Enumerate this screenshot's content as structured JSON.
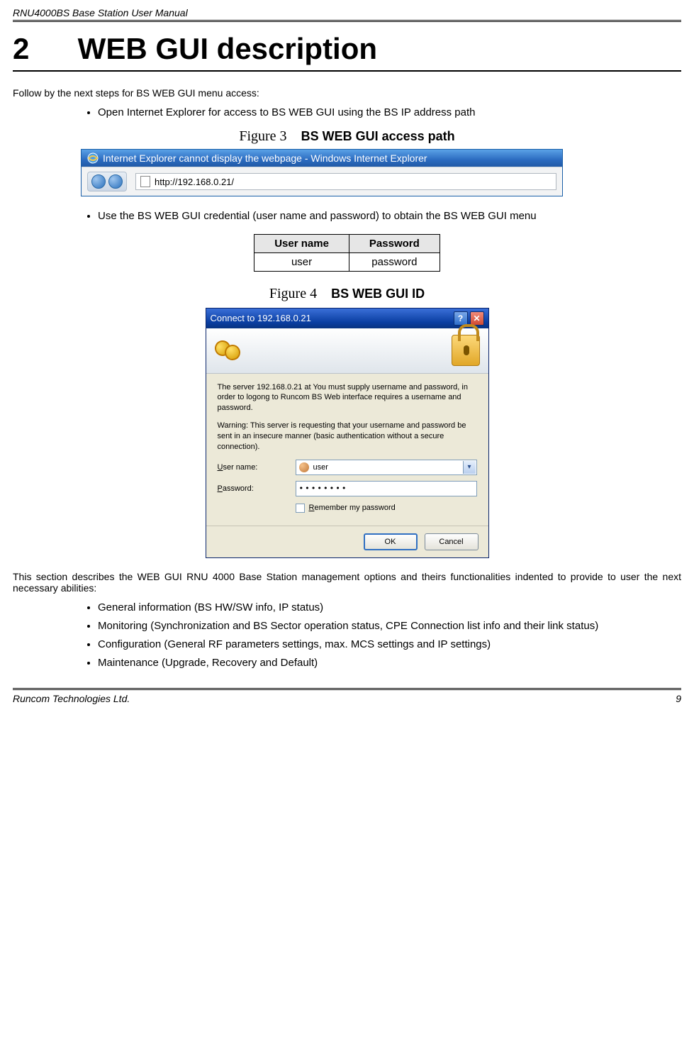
{
  "header": {
    "title": "RNU4000BS Base Station User Manual"
  },
  "heading": {
    "number": "2",
    "title": "WEB GUI description"
  },
  "intro": "Follow by the next steps for BS WEB GUI menu access:",
  "bullet1": "Open Internet Explorer for access to BS WEB GUI using the BS IP address path",
  "fig3": {
    "label": "Figure 3",
    "title": "BS WEB GUI access path"
  },
  "ie": {
    "titlebar": "Internet Explorer cannot display the webpage - Windows Internet Explorer",
    "url": "http://192.168.0.21/"
  },
  "bullet2": "Use the BS WEB GUI credential (user name and password) to obtain the BS WEB GUI menu",
  "cred_table": {
    "headers": [
      "User name",
      "Password"
    ],
    "row": [
      "user",
      "password"
    ]
  },
  "fig4": {
    "label": "Figure 4",
    "title": "BS WEB GUI ID"
  },
  "dialog": {
    "title": "Connect to 192.168.0.21",
    "p1": "The server 192.168.0.21 at You must supply username and password, in order to logong to Runcom BS Web interface requires a username and password.",
    "p2": "Warning: This server is requesting that your username and password be sent in an insecure manner (basic authentication without a secure connection).",
    "username_label_u": "U",
    "username_label_rest": "ser name:",
    "password_label_p": "P",
    "password_label_rest": "assword:",
    "username_value": "user",
    "password_value": "••••••••",
    "remember_r": "R",
    "remember_rest": "emember my password",
    "ok": "OK",
    "cancel": "Cancel"
  },
  "section_desc": "This section describes the WEB GUI RNU 4000 Base Station management options and theirs functionalities indented to provide to user the next necessary abilities:",
  "abilities": [
    "General information (BS HW/SW info, IP status)",
    "Monitoring (Synchronization and BS Sector operation status, CPE Connection list info and their link status)",
    "Configuration (General RF parameters settings, max. MCS settings and IP settings)",
    "Maintenance (Upgrade, Recovery and Default)"
  ],
  "footer": {
    "left": "Runcom Technologies Ltd.",
    "right": "9"
  }
}
